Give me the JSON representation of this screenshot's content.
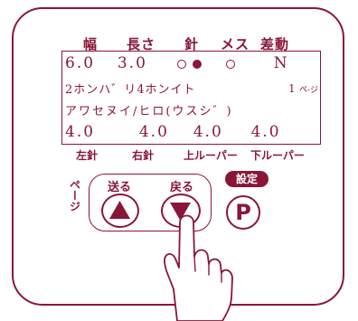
{
  "header": {
    "width": "幅",
    "length": "長さ",
    "needle": "針",
    "female": "メス",
    "differential": "差動"
  },
  "screen": {
    "row1": {
      "width_value": "6.0",
      "length_value": "3.0",
      "differential_value": "N"
    },
    "row2": {
      "text": "2ホンハ゛リ4ホンイト",
      "page_num": "1",
      "page_unit": "ペ-ジ"
    },
    "row3": {
      "text": "アワセヌイ/ヒロ(ウスシ゛)"
    },
    "row4": {
      "left_needle": "4.0",
      "right_needle": "4.0",
      "upper_looper": "4.0",
      "lower_looper": "4.0"
    }
  },
  "bottom_labels": {
    "left_needle": "左針",
    "right_needle": "右針",
    "upper_looper": "上ルーパー",
    "lower_looper": "下ルーパー"
  },
  "page_label": "ページ",
  "buttons": {
    "forward_label": "送る",
    "back_label": "戻る",
    "set_label": "設定",
    "p_label": "P"
  },
  "icons": {
    "forward": "triangle-up-icon",
    "back": "triangle-down-icon",
    "hand": "pointing-finger-icon"
  },
  "colors": {
    "accent": "#8a1637"
  }
}
